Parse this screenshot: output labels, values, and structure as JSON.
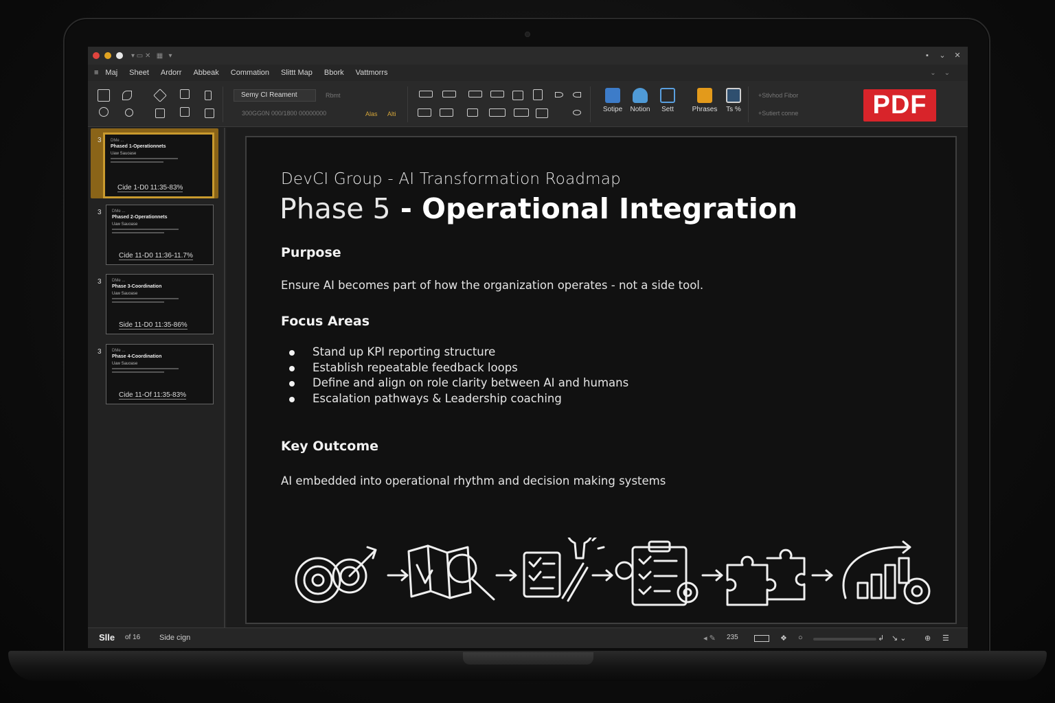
{
  "window": {
    "title_controls": [
      "▪",
      "⌄",
      "✕"
    ]
  },
  "menu": {
    "items": [
      "Maj",
      "Sheet",
      "Ardorr",
      "Abbeak",
      "Commation",
      "Slittt Map",
      "Bbork",
      "Vattmorrs"
    ]
  },
  "ribbon": {
    "font_name": "Semy CI Reament",
    "font_size_text": "Rbmt",
    "font_detail_text": "300GG0N 000/1800 00000000",
    "alt_label_1": "Alas",
    "alt_label_2": "Alti",
    "big_buttons": [
      "Sotipe",
      "Notion",
      "Sett",
      "Phrases",
      "Ts %"
    ],
    "right_text_1": "+Stlvhod Fibor",
    "right_text_2": "+Sutiert conne",
    "pdf_badge": "PDF"
  },
  "thumbnails": [
    {
      "number": "3",
      "line1": "DMe ...",
      "line2": "Phased 1-Operationnets",
      "line3": "Uaw Sauoase",
      "footer": "Cide 1-D0 11:35-83%",
      "active": true
    },
    {
      "number": "3",
      "line1": "DMe ...",
      "line2": "Phased 2-Operationnets",
      "line3": "Uaw Sauoase",
      "footer": "Cide 11-D0 11:36-11.7%",
      "active": false
    },
    {
      "number": "3",
      "line1": "DMe ...",
      "line2": "Phase 3-Coordination",
      "line3": "Uaw Sauoase",
      "footer": "Side 11-D0 11:35-86%",
      "active": false
    },
    {
      "number": "3",
      "line1": "DMe ...",
      "line2": "Phase 4-Coordination",
      "line3": "Uaw Sauoase",
      "footer": "Cide 11-Of 11:35-83%",
      "active": false
    }
  ],
  "slide": {
    "subtitle": "DevCI Group - AI Transformation Roadmap",
    "title_light": "Phase 5",
    "title_dash": " - ",
    "title_bold": "Operational Integration",
    "purpose_heading": "Purpose",
    "purpose_text": "Ensure AI becomes part of how the organization operates - not a side tool.",
    "focus_heading": "Focus Areas",
    "focus_items": [
      "Stand up KPI reporting structure",
      "Establish repeatable feedback loops",
      "Define and align on role clarity between AI and humans",
      "Escalation pathways & Leadership coaching"
    ],
    "outcome_heading": "Key Outcome",
    "outcome_text": "AI embedded into operational rhythm and decision making systems",
    "illustration_icons": [
      "target-icon",
      "map-search-icon",
      "checklist-idea-icon",
      "clipboard-gear-icon",
      "puzzle-icon",
      "growth-chart-gear-icon"
    ]
  },
  "status": {
    "slide_label": "Slle",
    "slide_count": "of 16",
    "slide_design": "Side cign",
    "zoom_text": "235"
  }
}
